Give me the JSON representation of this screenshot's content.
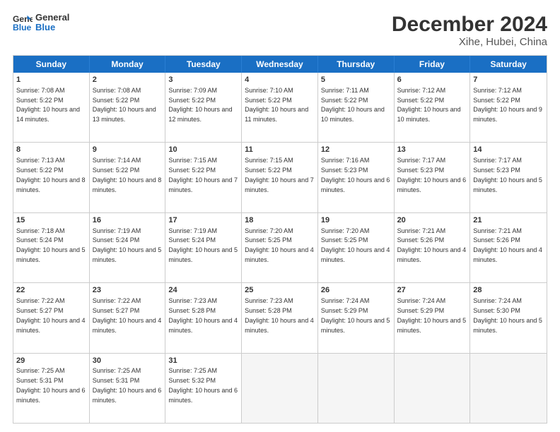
{
  "logo": {
    "line1": "General",
    "line2": "Blue"
  },
  "title": "December 2024",
  "subtitle": "Xihe, Hubei, China",
  "days": [
    "Sunday",
    "Monday",
    "Tuesday",
    "Wednesday",
    "Thursday",
    "Friday",
    "Saturday"
  ],
  "weeks": [
    [
      {
        "num": "1",
        "rise": "7:08 AM",
        "set": "5:22 PM",
        "daylight": "10 hours and 14 minutes."
      },
      {
        "num": "2",
        "rise": "7:08 AM",
        "set": "5:22 PM",
        "daylight": "10 hours and 13 minutes."
      },
      {
        "num": "3",
        "rise": "7:09 AM",
        "set": "5:22 PM",
        "daylight": "10 hours and 12 minutes."
      },
      {
        "num": "4",
        "rise": "7:10 AM",
        "set": "5:22 PM",
        "daylight": "10 hours and 11 minutes."
      },
      {
        "num": "5",
        "rise": "7:11 AM",
        "set": "5:22 PM",
        "daylight": "10 hours and 10 minutes."
      },
      {
        "num": "6",
        "rise": "7:12 AM",
        "set": "5:22 PM",
        "daylight": "10 hours and 10 minutes."
      },
      {
        "num": "7",
        "rise": "7:12 AM",
        "set": "5:22 PM",
        "daylight": "10 hours and 9 minutes."
      }
    ],
    [
      {
        "num": "8",
        "rise": "7:13 AM",
        "set": "5:22 PM",
        "daylight": "10 hours and 8 minutes."
      },
      {
        "num": "9",
        "rise": "7:14 AM",
        "set": "5:22 PM",
        "daylight": "10 hours and 8 minutes."
      },
      {
        "num": "10",
        "rise": "7:15 AM",
        "set": "5:22 PM",
        "daylight": "10 hours and 7 minutes."
      },
      {
        "num": "11",
        "rise": "7:15 AM",
        "set": "5:22 PM",
        "daylight": "10 hours and 7 minutes."
      },
      {
        "num": "12",
        "rise": "7:16 AM",
        "set": "5:23 PM",
        "daylight": "10 hours and 6 minutes."
      },
      {
        "num": "13",
        "rise": "7:17 AM",
        "set": "5:23 PM",
        "daylight": "10 hours and 6 minutes."
      },
      {
        "num": "14",
        "rise": "7:17 AM",
        "set": "5:23 PM",
        "daylight": "10 hours and 5 minutes."
      }
    ],
    [
      {
        "num": "15",
        "rise": "7:18 AM",
        "set": "5:24 PM",
        "daylight": "10 hours and 5 minutes."
      },
      {
        "num": "16",
        "rise": "7:19 AM",
        "set": "5:24 PM",
        "daylight": "10 hours and 5 minutes."
      },
      {
        "num": "17",
        "rise": "7:19 AM",
        "set": "5:24 PM",
        "daylight": "10 hours and 5 minutes."
      },
      {
        "num": "18",
        "rise": "7:20 AM",
        "set": "5:25 PM",
        "daylight": "10 hours and 4 minutes."
      },
      {
        "num": "19",
        "rise": "7:20 AM",
        "set": "5:25 PM",
        "daylight": "10 hours and 4 minutes."
      },
      {
        "num": "20",
        "rise": "7:21 AM",
        "set": "5:26 PM",
        "daylight": "10 hours and 4 minutes."
      },
      {
        "num": "21",
        "rise": "7:21 AM",
        "set": "5:26 PM",
        "daylight": "10 hours and 4 minutes."
      }
    ],
    [
      {
        "num": "22",
        "rise": "7:22 AM",
        "set": "5:27 PM",
        "daylight": "10 hours and 4 minutes."
      },
      {
        "num": "23",
        "rise": "7:22 AM",
        "set": "5:27 PM",
        "daylight": "10 hours and 4 minutes."
      },
      {
        "num": "24",
        "rise": "7:23 AM",
        "set": "5:28 PM",
        "daylight": "10 hours and 4 minutes."
      },
      {
        "num": "25",
        "rise": "7:23 AM",
        "set": "5:28 PM",
        "daylight": "10 hours and 4 minutes."
      },
      {
        "num": "26",
        "rise": "7:24 AM",
        "set": "5:29 PM",
        "daylight": "10 hours and 5 minutes."
      },
      {
        "num": "27",
        "rise": "7:24 AM",
        "set": "5:29 PM",
        "daylight": "10 hours and 5 minutes."
      },
      {
        "num": "28",
        "rise": "7:24 AM",
        "set": "5:30 PM",
        "daylight": "10 hours and 5 minutes."
      }
    ],
    [
      {
        "num": "29",
        "rise": "7:25 AM",
        "set": "5:31 PM",
        "daylight": "10 hours and 6 minutes."
      },
      {
        "num": "30",
        "rise": "7:25 AM",
        "set": "5:31 PM",
        "daylight": "10 hours and 6 minutes."
      },
      {
        "num": "31",
        "rise": "7:25 AM",
        "set": "5:32 PM",
        "daylight": "10 hours and 6 minutes."
      },
      null,
      null,
      null,
      null
    ]
  ]
}
